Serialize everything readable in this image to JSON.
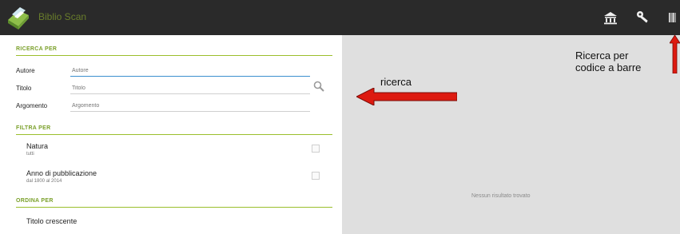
{
  "topbar": {
    "app_title": "Biblio Scan",
    "colors": {
      "bar": "#2a2a2a",
      "accent": "#9bbf2c"
    },
    "icons": [
      "library-icon",
      "key-icon",
      "barcode-icon"
    ]
  },
  "search": {
    "section_title": "RICERCA PER",
    "fields": [
      {
        "label": "Autore",
        "placeholder": "Autore",
        "value": ""
      },
      {
        "label": "Titolo",
        "placeholder": "Titolo",
        "value": ""
      },
      {
        "label": "Argomento",
        "placeholder": "Argomento",
        "value": ""
      }
    ]
  },
  "filters": {
    "section_title": "FILTRA PER",
    "items": [
      {
        "title": "Natura",
        "subtitle": "tutti"
      },
      {
        "title": "Anno di pubblicazione",
        "subtitle": "dal 1800 al 2014"
      }
    ]
  },
  "order": {
    "section_title": "ORDINA PER",
    "items": [
      {
        "title": "Titolo crescente"
      }
    ]
  },
  "results": {
    "empty_message": "Nessun risultato trovato"
  },
  "annotations": {
    "search_label": "ricerca",
    "barcode_label_line1": "Ricerca per",
    "barcode_label_line2": "codice a barre",
    "arrow_color": "#dd1a10"
  }
}
